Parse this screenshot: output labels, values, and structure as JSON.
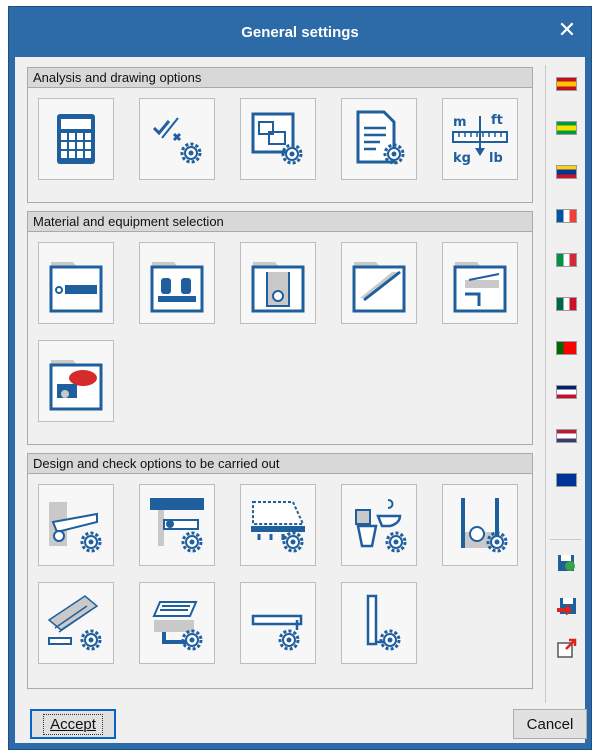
{
  "window": {
    "title": "General settings",
    "close_glyph": "✕"
  },
  "groups": [
    {
      "label": "Analysis and drawing options",
      "tiles": [
        "calculator-icon",
        "check-cross-gear-icon",
        "drawing-layout-gear-icon",
        "document-gear-icon",
        "units-m-ft-kg-lb-icon"
      ]
    },
    {
      "label": "Material and equipment selection",
      "tiles": [
        "folder-pipe-icon",
        "folder-fixtures-icon",
        "folder-manhole-icon",
        "folder-gutter-icon",
        "folder-drain-icon",
        "folder-pump-brand-icon"
      ]
    },
    {
      "label": "Design and check options to be carried out",
      "tiles": [
        "pipe-wall-gear-icon",
        "ceiling-pipe-gear-icon",
        "slab-hangers-gear-icon",
        "sanitary-fixtures-gear-icon",
        "manhole-gear-icon",
        "roof-gutter-gear-icon",
        "grated-drain-gear-icon",
        "horizontal-pipe-gear-icon",
        "vertical-pipe-gear-icon"
      ]
    }
  ],
  "language_flags": [
    {
      "name": "spain-flag-icon",
      "colors": [
        "#c60b1e",
        "#ffc400",
        "#c60b1e"
      ]
    },
    {
      "name": "brazil-flag-icon",
      "colors": [
        "#009b3a",
        "#fedf00",
        "#009b3a"
      ]
    },
    {
      "name": "colombia-flag-icon",
      "colors": [
        "#fcd116",
        "#003893",
        "#ce1126"
      ]
    },
    {
      "name": "france-flag-icon",
      "colors": [
        "#0055a4",
        "#ffffff",
        "#ef4135"
      ]
    },
    {
      "name": "italy-flag-icon",
      "colors": [
        "#009246",
        "#ffffff",
        "#ce2b37"
      ]
    },
    {
      "name": "mexico-flag-icon",
      "colors": [
        "#006847",
        "#ffffff",
        "#ce1126"
      ]
    },
    {
      "name": "portugal-flag-icon",
      "colors": [
        "#006600",
        "#ff0000",
        "#ff0000"
      ]
    },
    {
      "name": "uk-flag-icon",
      "colors": [
        "#012169",
        "#ffffff",
        "#c8102e"
      ]
    },
    {
      "name": "usa-flag-icon",
      "colors": [
        "#b22234",
        "#ffffff",
        "#3c3b6e"
      ]
    },
    {
      "name": "eu-flag-icon",
      "colors": [
        "#003399",
        "#003399",
        "#ffcc00"
      ]
    }
  ],
  "side_tools": [
    "import-settings-icon",
    "export-settings-icon",
    "open-external-icon"
  ],
  "buttons": {
    "accept": "Accept",
    "cancel": "Cancel"
  },
  "colors": {
    "titlebar": "#2d6aa8",
    "icon_blue": "#1f5f9e",
    "icon_gray": "#c9c9c9"
  }
}
